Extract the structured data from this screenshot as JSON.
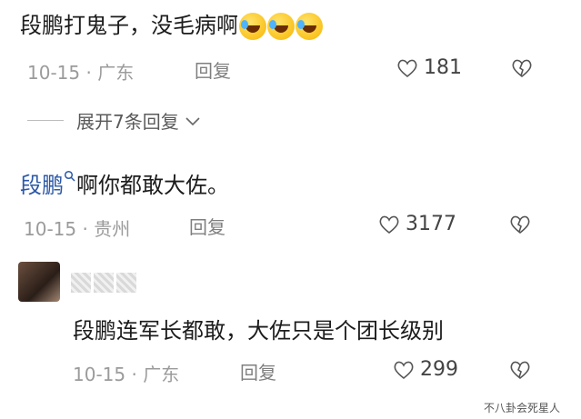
{
  "comments": [
    {
      "text": "段鹏打鬼子，没毛病啊",
      "emojis": [
        "laugh-cry-emoji",
        "laugh-cry-emoji",
        "laugh-cry-emoji"
      ],
      "date": "10-15",
      "location": "广东",
      "reply_label": "回复",
      "likes": "181"
    },
    {
      "user_link": "段鹏",
      "text": "啊你都敢大佐。",
      "date": "10-15",
      "location": "贵州",
      "reply_label": "回复",
      "likes": "3177"
    },
    {
      "text": "段鹏连军长都敢，大佐只是个团长级别",
      "date": "10-15",
      "location": "广东",
      "reply_label": "回复",
      "likes": "299"
    }
  ],
  "expand_replies": "展开7条回复",
  "separator": "·",
  "watermark": "不八卦会死星人",
  "colors": {
    "link": "#2c58a6",
    "meta": "#9b9b9b"
  }
}
